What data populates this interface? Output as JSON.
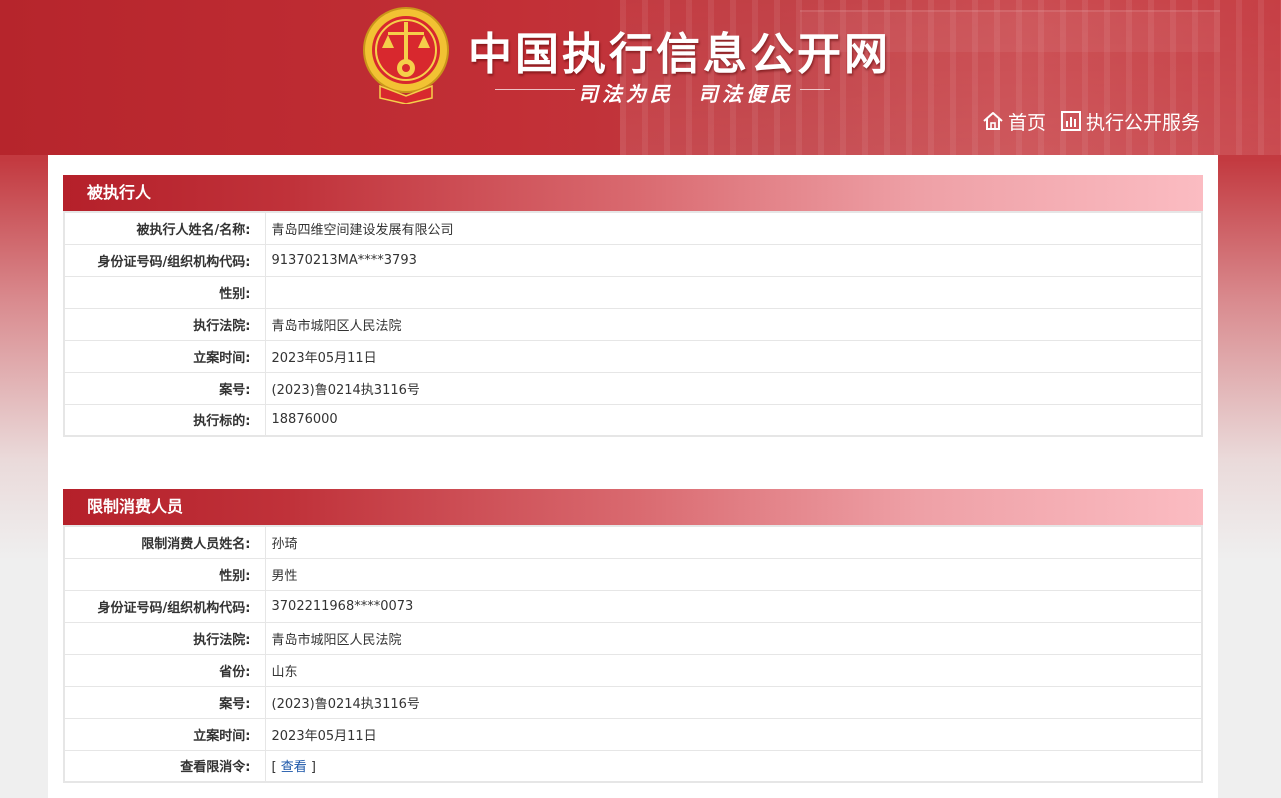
{
  "header": {
    "site_title": "中国执行信息公开网",
    "slogan": "司法为民　司法便民",
    "nav": {
      "home_label": "首页",
      "service_label": "执行公开服务"
    }
  },
  "colors": {
    "brand_red": "#b6252c",
    "link_blue": "#1a55a8",
    "border_gray": "#e6e6e6"
  },
  "executed_person": {
    "section_title": "被执行人",
    "rows": [
      {
        "label": "被执行人姓名/名称:",
        "value": "青岛四维空间建设发展有限公司"
      },
      {
        "label": "身份证号码/组织机构代码:",
        "value": "91370213MA****3793"
      },
      {
        "label": "性别:",
        "value": ""
      },
      {
        "label": "执行法院:",
        "value": "青岛市城阳区人民法院"
      },
      {
        "label": "立案时间:",
        "value": "2023年05月11日"
      },
      {
        "label": "案号:",
        "value": "(2023)鲁0214执3116号"
      },
      {
        "label": "执行标的:",
        "value": "18876000"
      }
    ]
  },
  "restricted_person": {
    "section_title": "限制消费人员",
    "rows": [
      {
        "label": "限制消费人员姓名:",
        "value": "孙琦"
      },
      {
        "label": "性别:",
        "value": "男性"
      },
      {
        "label": "身份证号码/组织机构代码:",
        "value": "3702211968****0073"
      },
      {
        "label": "执行法院:",
        "value": "青岛市城阳区人民法院"
      },
      {
        "label": "省份:",
        "value": "山东"
      },
      {
        "label": "案号:",
        "value": "(2023)鲁0214执3116号"
      },
      {
        "label": "立案时间:",
        "value": "2023年05月11日"
      }
    ],
    "order_row": {
      "label": "查看限消令:",
      "bracket_open": "[",
      "link_text": "查看",
      "bracket_close": "]"
    }
  }
}
